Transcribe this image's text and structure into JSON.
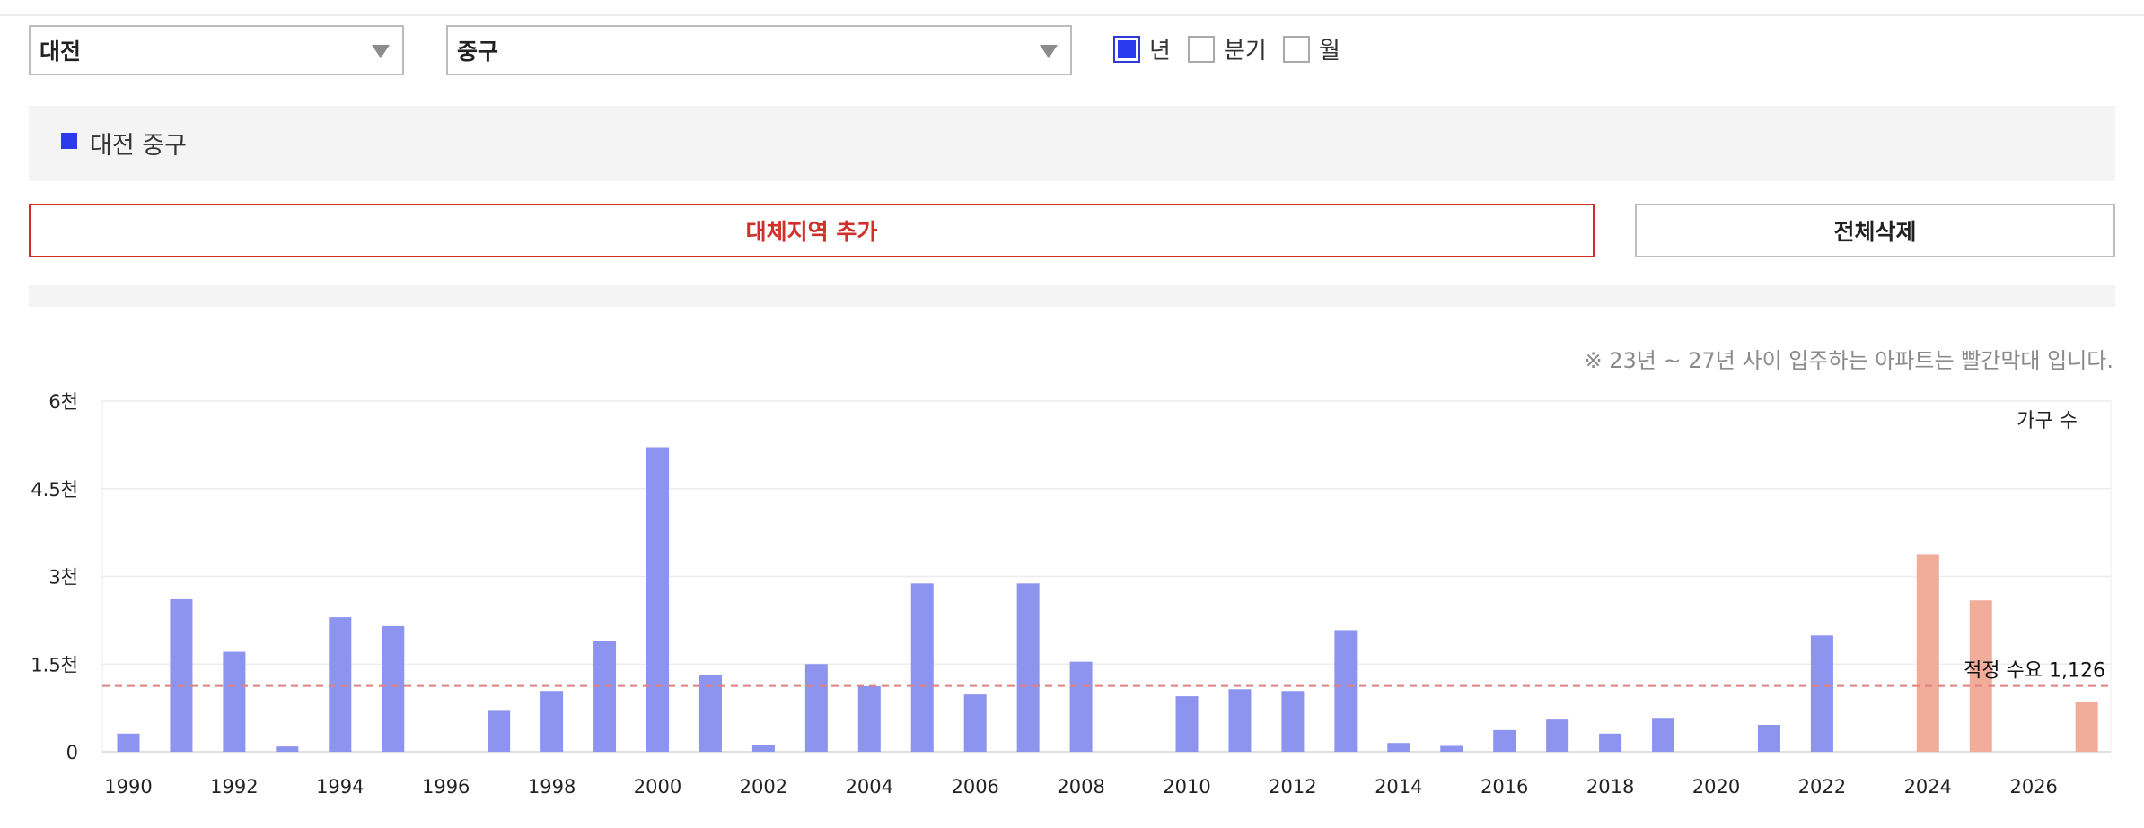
{
  "filters": {
    "region": "대전",
    "district": "중구",
    "periods": [
      {
        "label": "년",
        "checked": true
      },
      {
        "label": "분기",
        "checked": false
      },
      {
        "label": "월",
        "checked": false
      }
    ]
  },
  "legend": {
    "label": "대전 중구",
    "color": "#2b3bea"
  },
  "buttons": {
    "add": "대체지역 추가",
    "clear": "전체삭제"
  },
  "note": "※ 23년 ~ 27년 사이 입주하는 아파트는 빨간막대 입니다.",
  "colors": {
    "normal_bar": "#8c94f0",
    "highlight_bar": "#f2ad9a",
    "reference_line": "#e08080"
  },
  "chart_data": {
    "type": "bar",
    "series_label": "가구 수",
    "categories": [
      "1990",
      "1991",
      "1992",
      "1993",
      "1994",
      "1995",
      "1996",
      "1997",
      "1998",
      "1999",
      "2000",
      "2001",
      "2002",
      "2003",
      "2004",
      "2005",
      "2006",
      "2007",
      "2008",
      "2009",
      "2010",
      "2011",
      "2012",
      "2013",
      "2014",
      "2015",
      "2016",
      "2017",
      "2018",
      "2019",
      "2020",
      "2021",
      "2022",
      "2023",
      "2024",
      "2025",
      "2026",
      "2027"
    ],
    "values": [
      310,
      2610,
      1710,
      90,
      2300,
      2150,
      0,
      700,
      1040,
      1900,
      5210,
      1320,
      120,
      1500,
      1120,
      2880,
      980,
      2880,
      1540,
      0,
      950,
      1070,
      1040,
      2080,
      150,
      100,
      370,
      550,
      310,
      580,
      0,
      460,
      1990,
      0,
      3370,
      2590,
      0,
      860
    ],
    "highlight_years": [
      "2024",
      "2025",
      "2026",
      "2027"
    ],
    "ylim": [
      0,
      6000
    ],
    "yticks": [
      0,
      1500,
      3000,
      4500,
      6000
    ],
    "ytick_labels": [
      "0",
      "1.5천",
      "3천",
      "4.5천",
      "6천"
    ],
    "xtick_labels": [
      "1990",
      "1992",
      "1994",
      "1996",
      "1998",
      "2000",
      "2002",
      "2004",
      "2006",
      "2008",
      "2010",
      "2012",
      "2014",
      "2016",
      "2018",
      "2020",
      "2022",
      "2024",
      "2026"
    ],
    "reference_line": {
      "label": "적정 수요 1,126",
      "value": 1126
    },
    "grid": true
  }
}
